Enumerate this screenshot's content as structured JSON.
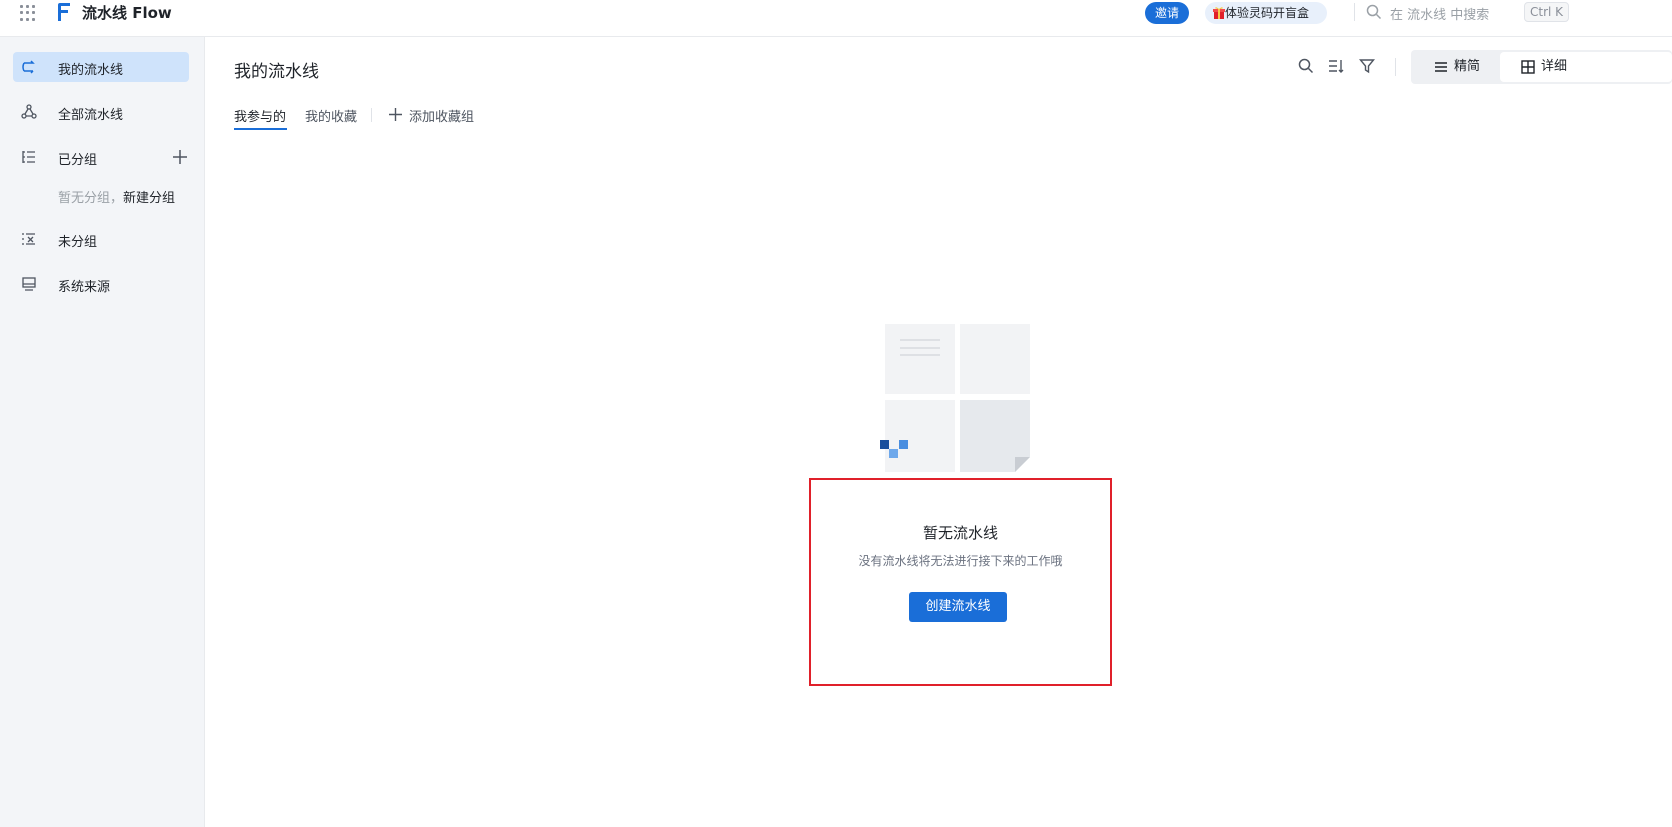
{
  "header": {
    "brand": "流水线 Flow",
    "invite_label": "邀请",
    "blind_box_label": "体验灵码开盲盒",
    "search_placeholder": "在 流水线 中搜索",
    "shortcut": "Ctrl K"
  },
  "sidebar": {
    "items": [
      {
        "label": "我的流水线",
        "icon": "pipeline-icon",
        "active": true
      },
      {
        "label": "全部流水线",
        "icon": "nodes-icon"
      },
      {
        "label": "已分组",
        "icon": "list-tree-icon"
      },
      {
        "label": "未分组",
        "icon": "ungrouped-icon"
      },
      {
        "label": "系统来源",
        "icon": "monitor-icon"
      }
    ],
    "empty_group_text": "暂无分组，",
    "new_group_link": "新建分组"
  },
  "main": {
    "title": "我的流水线",
    "tabs": [
      {
        "label": "我参与的",
        "active": true
      },
      {
        "label": "我的收藏"
      }
    ],
    "add_favorite_group": "添加收藏组",
    "view_modes": [
      "精简",
      "详细"
    ],
    "empty_state": {
      "title": "暂无流水线",
      "description": "没有流水线将无法进行接下来的工作哦",
      "create_button": "创建流水线"
    }
  },
  "colors": {
    "accent": "#1a6ed8",
    "sidebar_bg": "#f3f5f8",
    "active_item_bg": "#cfe3fb",
    "highlight_border": "#e0202a"
  }
}
